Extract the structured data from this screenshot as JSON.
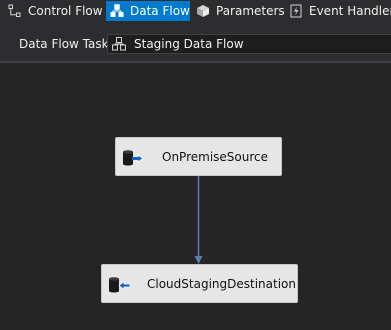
{
  "tabs": [
    {
      "label": "Control Flow",
      "icon": "control-flow-icon",
      "active": false
    },
    {
      "label": "Data Flow",
      "icon": "data-flow-icon",
      "active": true
    },
    {
      "label": "Parameters",
      "icon": "parameters-icon",
      "active": false
    },
    {
      "label": "Event Handlers",
      "icon": "event-handlers-icon",
      "active": false
    }
  ],
  "task": {
    "label": "Data Flow Task:",
    "selected": "Staging Data Flow",
    "icon": "data-flow-task-icon"
  },
  "components": [
    {
      "name": "OnPremiseSource",
      "type": "source",
      "icon": "source-adapter-icon"
    },
    {
      "name": "CloudStagingDestination",
      "type": "destination",
      "icon": "destination-adapter-icon"
    }
  ],
  "colors": {
    "accent": "#007acc",
    "background": "#252526",
    "toolbar": "#2d2d30",
    "component_fill": "#e6e6e6",
    "connector": "#5a7dae",
    "adapter_arrow": "#1565c0"
  }
}
